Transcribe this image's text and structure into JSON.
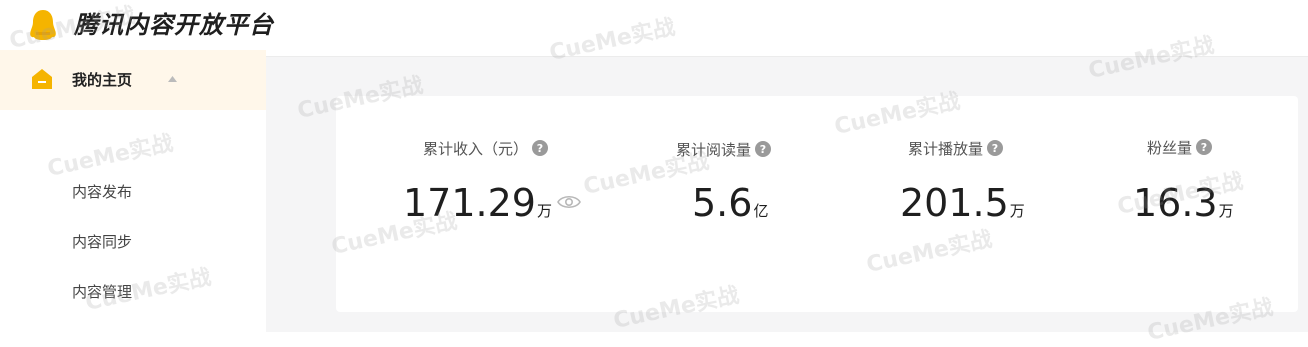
{
  "header": {
    "brand": "腾讯内容开放平台"
  },
  "sidebar": {
    "home_label": "我的主页",
    "items": [
      {
        "label": "内容发布"
      },
      {
        "label": "内容同步"
      },
      {
        "label": "内容管理"
      }
    ]
  },
  "stats": [
    {
      "label": "累计收入（元）",
      "value": "171.29",
      "unit": "万"
    },
    {
      "label": "累计阅读量",
      "value": "5.6",
      "unit": "亿"
    },
    {
      "label": "累计播放量",
      "value": "201.5",
      "unit": "万"
    },
    {
      "label": "粉丝量",
      "value": "16.3",
      "unit": "万"
    }
  ],
  "watermark": "CueMe实战",
  "colors": {
    "accent": "#f5b400",
    "active_bg": "#fff7ea",
    "page_bg": "#f5f5f6"
  }
}
